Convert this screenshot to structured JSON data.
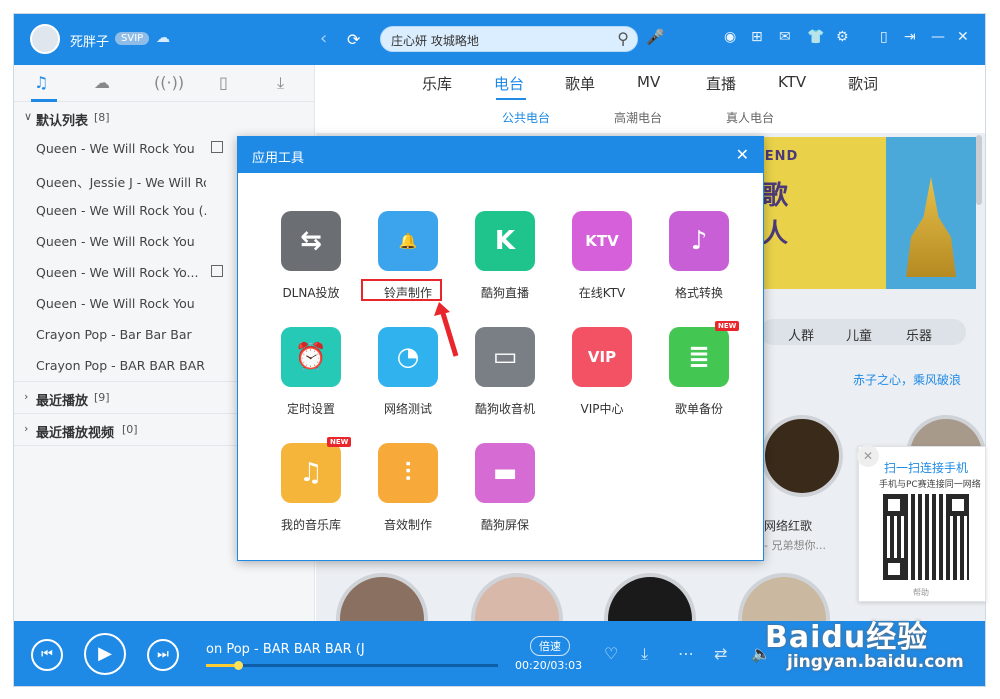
{
  "header": {
    "username": "死胖子",
    "vip_badge": "SVIP",
    "search_value": "庄心妍 攻城略地"
  },
  "left": {
    "default_list": {
      "label": "默认列表",
      "count": "[8]"
    },
    "songs": [
      {
        "title": "Queen - We Will Rock You",
        "mv": true
      },
      {
        "title": "Queen、Jessie J - We Will Ro...",
        "mv": false
      },
      {
        "title": "Queen - We Will Rock You (...",
        "mv": false
      },
      {
        "title": "Queen - We Will Rock You",
        "mv": false
      },
      {
        "title": "Queen - We Will Rock Yo...",
        "mv": true
      },
      {
        "title": "Queen - We Will Rock You",
        "mv": false
      },
      {
        "title": "Crayon Pop - Bar Bar Bar",
        "mv": false
      },
      {
        "title": "Crayon Pop - BAR BAR BAR (...",
        "mv": false
      }
    ],
    "recent_play": {
      "label": "最近播放",
      "count": "[9]"
    },
    "recent_video": {
      "label": "最近播放视频",
      "count": "[0]"
    }
  },
  "main_tabs": [
    "乐库",
    "电台",
    "歌单",
    "MV",
    "直播",
    "KTV",
    "歌词"
  ],
  "sub_tabs": [
    "公共电台",
    "高潮电台",
    "真人电台"
  ],
  "banner": {
    "line1": "FRIEND",
    "line2": "的歌",
    "line3": "的人"
  },
  "categories": [
    "人群",
    "儿童",
    "乐器"
  ],
  "slogan": "赤子之心，乘风破浪",
  "radio_items": [
    {
      "title": "网络红歌",
      "subtitle": "- 兄弟想你..."
    }
  ],
  "dialog": {
    "title": "应用工具",
    "tools": [
      {
        "label": "DLNA投放",
        "color": "#6b6f74",
        "glyph": "⇆",
        "new": false
      },
      {
        "label": "铃声制作",
        "color": "#3ba4ec",
        "glyph": "🔔",
        "new": false
      },
      {
        "label": "酷狗直播",
        "color": "#1ec48c",
        "glyph": "K",
        "new": false
      },
      {
        "label": "在线KTV",
        "color": "#d560d9",
        "glyph": "KTV",
        "new": false
      },
      {
        "label": "格式转换",
        "color": "#c85fd6",
        "glyph": "♪",
        "new": false
      },
      {
        "label": "定时设置",
        "color": "#25c9b5",
        "glyph": "⏰",
        "new": false
      },
      {
        "label": "网络测试",
        "color": "#2fb2ee",
        "glyph": "◔",
        "new": false
      },
      {
        "label": "酷狗收音机",
        "color": "#7a7f86",
        "glyph": "▭",
        "new": false
      },
      {
        "label": "VIP中心",
        "color": "#f25263",
        "glyph": "VIP",
        "new": false
      },
      {
        "label": "歌单备份",
        "color": "#43c652",
        "glyph": "≣",
        "new": true
      },
      {
        "label": "我的音乐库",
        "color": "#f5b53a",
        "glyph": "♫",
        "new": true
      },
      {
        "label": "音效制作",
        "color": "#f7a93a",
        "glyph": "⫶",
        "new": false
      },
      {
        "label": "酷狗屏保",
        "color": "#d56bd3",
        "glyph": "▬",
        "new": false
      }
    ],
    "new_tag": "NEW"
  },
  "player": {
    "now_playing": "on Pop - BAR BAR BAR (J",
    "speed_label": "倍速",
    "time": "00:20/03:03",
    "progress": 0.11
  },
  "qr": {
    "title": "扫一扫连接手机",
    "subtitle": "手机与PC赛连接同一网络",
    "help": "帮助"
  },
  "watermark": {
    "line1": "Baidu经验",
    "line2": "jingyan.baidu.com"
  },
  "colors": {
    "primary": "#1e8ae6",
    "highlight": "#e8262b"
  }
}
